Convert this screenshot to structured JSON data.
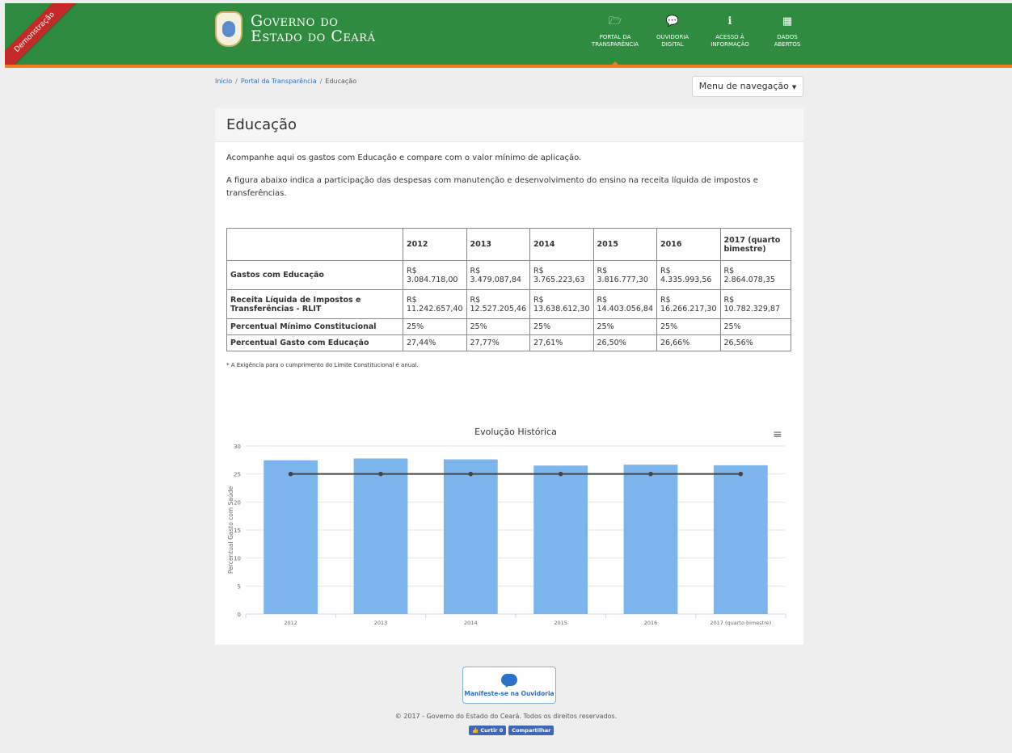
{
  "ribbon": "Demonstração",
  "brand": {
    "line1": "Governo do",
    "line2": "Estado do Ceará"
  },
  "topnav": [
    {
      "icon": "folder-open-icon",
      "glyph": "🗁",
      "line1": "PORTAL DA",
      "line2": "TRANSPARÊNCIA"
    },
    {
      "icon": "chat-bubble-icon",
      "glyph": "💬",
      "line1": "OUVIDORIA",
      "line2": "DIGITAL"
    },
    {
      "icon": "info-icon",
      "glyph": "ℹ",
      "line1": "ACESSO À",
      "line2": "INFORMAÇÃO"
    },
    {
      "icon": "grid-icon",
      "glyph": "▦",
      "line1": "DADOS",
      "line2": "ABERTOS"
    }
  ],
  "breadcrumb": {
    "home": "Início",
    "portal": "Portal da Transparência",
    "current": "Educação",
    "separator": "/"
  },
  "menu_button": "Menu de navegação",
  "page": {
    "title": "Educação",
    "intro1": "Acompanhe aqui os gastos com Educação e compare com o valor mínimo de aplicação.",
    "intro2": "A figura abaixo indica a participação das despesas com manutenção e desenvolvimento do ensino na receita líquida de impostos e transferências."
  },
  "table": {
    "headers": [
      "",
      "2012",
      "2013",
      "2014",
      "2015",
      "2016",
      "2017 (quarto bimestre)"
    ],
    "rows": [
      {
        "label": "Gastos com Educação",
        "cells": [
          "R$ 3.084.718,00",
          "R$ 3.479.087,84",
          "R$ 3.765.223,63",
          "R$ 3.816.777,30",
          "R$ 4.335.993,56",
          "R$ 2.864.078,35"
        ]
      },
      {
        "label": "Receita Líquida de Impostos e Transferências - RLIT",
        "cells": [
          "R$ 11.242.657,40",
          "R$ 12.527.205,46",
          "R$ 13.638.612,30",
          "R$ 14.403.056,84",
          "R$ 16.266.217,30",
          "R$ 10.782.329,87"
        ]
      },
      {
        "label": "Percentual Mínimo Constitucional",
        "cells": [
          "25%",
          "25%",
          "25%",
          "25%",
          "25%",
          "25%"
        ]
      },
      {
        "label": "Percentual Gasto com Educação",
        "cells": [
          "27,44%",
          "27,77%",
          "27,61%",
          "26,50%",
          "26,66%",
          "26,56%"
        ]
      }
    ],
    "note": "* A Exigência para o cumprimento do Limite Constitucional é anual."
  },
  "chart_data": {
    "type": "bar",
    "title": "Evolução Histórica",
    "ylabel": "Percentual Gasto com Saúde",
    "xlabel": "",
    "categories": [
      "2012",
      "2013",
      "2014",
      "2015",
      "2016",
      "2017 (quarto bimestre)"
    ],
    "ylim": [
      0,
      30
    ],
    "yticks": [
      0,
      5,
      10,
      15,
      20,
      25,
      30
    ],
    "grid": true,
    "series": [
      {
        "type": "bar",
        "values": [
          27.44,
          27.77,
          27.61,
          26.5,
          26.66,
          26.56
        ],
        "color": "#7cb5ec"
      },
      {
        "type": "line",
        "values": [
          25,
          25,
          25,
          25,
          25,
          25
        ],
        "color": "#434348"
      }
    ]
  },
  "footer": {
    "ouvidoria": "Manifeste-se na Ouvidoria",
    "copyright": "© 2017 - Governo do Estado do Ceará. Todos os direitos reservados.",
    "like": "Curtir 0",
    "share": "Compartilhar"
  },
  "colors": {
    "header": "#2e8b3f",
    "accent": "#f47b20",
    "link": "#2a72c9",
    "ribbon": "#c62828"
  }
}
